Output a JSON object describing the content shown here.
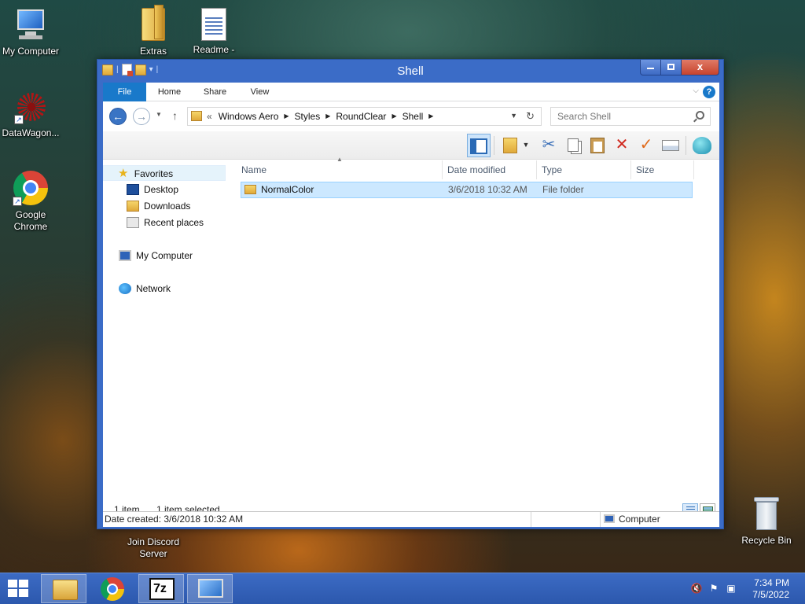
{
  "desktop": {
    "icons": [
      {
        "label": "My Computer"
      },
      {
        "label": "Extras"
      },
      {
        "label": "Readme -"
      },
      {
        "label": "DataWagon..."
      },
      {
        "label": "Google Chrome"
      },
      {
        "label": "Join Discord Server"
      },
      {
        "label": "Recycle Bin"
      }
    ]
  },
  "window": {
    "title": "Shell",
    "close_glyph": "x",
    "ribbon_tabs": [
      "File",
      "Home",
      "Share",
      "View"
    ],
    "help_glyph": "?",
    "address": {
      "lead": "«",
      "crumbs": [
        "Windows Aero",
        "Styles",
        "RoundClear",
        "Shell"
      ]
    },
    "search": {
      "placeholder": "Search Shell"
    },
    "nav_pane": {
      "favorites": "Favorites",
      "favorites_items": [
        "Desktop",
        "Downloads",
        "Recent places"
      ],
      "computer": "My Computer",
      "network": "Network"
    },
    "columns": [
      "Name",
      "Date modified",
      "Type",
      "Size"
    ],
    "rows": [
      {
        "name": "NormalColor",
        "date_modified": "3/6/2018 10:32 AM",
        "type": "File folder",
        "size": ""
      }
    ],
    "status": {
      "item_count": "1 item",
      "selected": "1 item selected",
      "date_created": "Date created: 3/6/2018 10:32 AM",
      "location": "Computer"
    }
  },
  "taskbar": {
    "time": "7:34 PM",
    "date": "7/5/2022",
    "seven_zip_label": "7z"
  },
  "colors": {
    "title_blue": "#3b6cc7",
    "file_tab": "#1979ca",
    "selection": "#cce8ff",
    "taskbar": "#2c58ad"
  }
}
